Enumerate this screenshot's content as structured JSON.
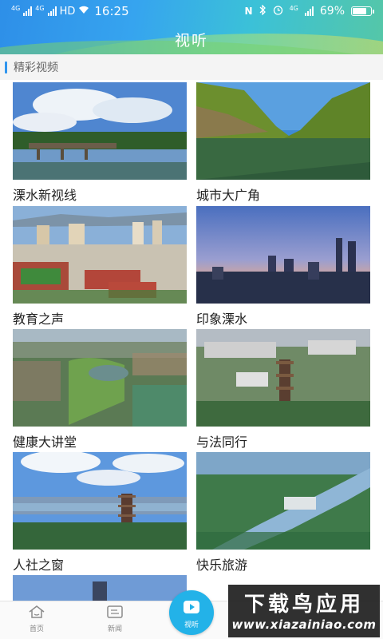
{
  "status_bar": {
    "time": "16:25",
    "network_left": "4G",
    "network_left_2": "4G",
    "hd": "HD",
    "network_right": "4G",
    "battery": "69%"
  },
  "header": {
    "title": "视听"
  },
  "section": {
    "label": "精彩视频"
  },
  "videos": [
    {
      "label": "溧水新视线"
    },
    {
      "label": "城市大广角"
    },
    {
      "label": "教育之声"
    },
    {
      "label": "印象溧水"
    },
    {
      "label": "健康大讲堂"
    },
    {
      "label": "与法同行"
    },
    {
      "label": "人社之窗"
    },
    {
      "label": "快乐旅游"
    }
  ],
  "bottom_nav": {
    "home": "首页",
    "news": "新闻",
    "av": "视听"
  },
  "watermark": {
    "title": "下载鸟应用",
    "url": "www.xiazainiao.com"
  },
  "colors": {
    "header_blue": "#2e8fe8",
    "accent": "#2f95ee",
    "nav_center": "#23b2e8"
  }
}
